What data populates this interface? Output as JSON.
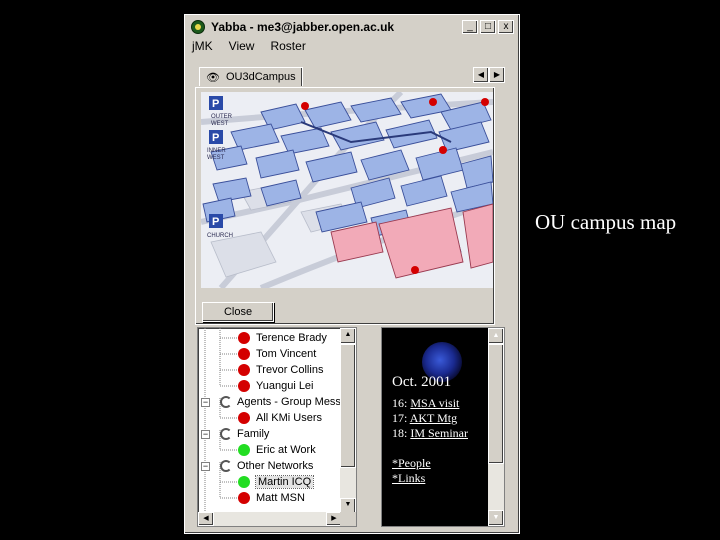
{
  "window": {
    "title": "Yabba - me3@jabber.open.ac.uk",
    "caption_buttons": {
      "minimize": "_",
      "maximize": "□",
      "close": "x"
    }
  },
  "menu": [
    "jMK",
    "View",
    "Roster"
  ],
  "tab": {
    "icon": "eye-icon",
    "label": "OU3dCampus"
  },
  "panel": {
    "close_label": "Close"
  },
  "map": {
    "labels": {
      "p1": "P",
      "p2": "P",
      "p3": "P",
      "outer": "OUTER",
      "west1": "WEST",
      "inner": "INNER",
      "west2": "WEST",
      "church": "CHURCH"
    },
    "colors": {
      "building": "#9db4e6",
      "building_outline": "#3a4f9a",
      "pink_building": "#f2aab8",
      "dot": "#d40000"
    }
  },
  "roster": {
    "items": [
      {
        "type": "contact",
        "name": "Terence Brady",
        "status": "red"
      },
      {
        "type": "contact",
        "name": "Tom Vincent",
        "status": "red"
      },
      {
        "type": "contact",
        "name": "Trevor Collins",
        "status": "red"
      },
      {
        "type": "contact",
        "name": "Yuangui Lei",
        "status": "red"
      },
      {
        "type": "group",
        "name": "Agents - Group Messeng",
        "expander": "−"
      },
      {
        "type": "contact",
        "name": "All KMi Users",
        "status": "red"
      },
      {
        "type": "group",
        "name": "Family",
        "expander": "−"
      },
      {
        "type": "contact",
        "name": "Eric at Work",
        "status": "green"
      },
      {
        "type": "group",
        "name": "Other Networks",
        "expander": "−"
      },
      {
        "type": "contact",
        "name": "Martin ICQ",
        "status": "green",
        "selected": true
      },
      {
        "type": "contact",
        "name": "Matt MSN",
        "status": "red"
      }
    ]
  },
  "news": {
    "title": "Oct. 2001",
    "events": [
      {
        "day": "16:",
        "label": "MSA visit"
      },
      {
        "day": "17:",
        "label": "AKT Mtg"
      },
      {
        "day": "18:",
        "label": "IM Seminar"
      }
    ],
    "links": [
      "*People",
      "*Links"
    ]
  },
  "caption": "OU campus map"
}
